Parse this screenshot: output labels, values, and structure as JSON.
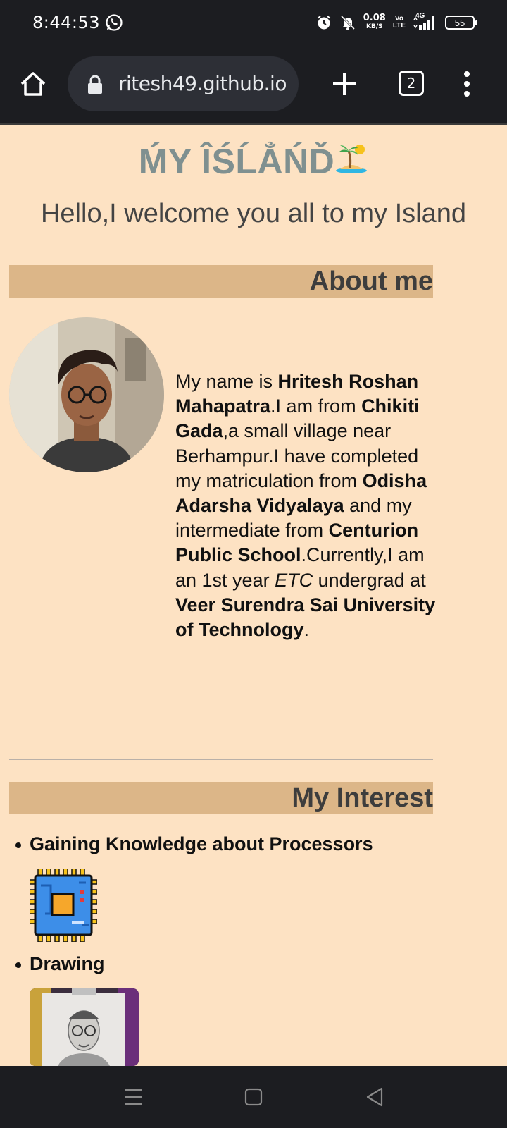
{
  "status_bar": {
    "time": "8:44:53",
    "net_speed_value": "0.08",
    "net_speed_unit": "KB/S",
    "volte_top": "Vo",
    "volte_bottom": "LTE",
    "network": "4G",
    "battery": "55"
  },
  "browser": {
    "url": "ritesh49.github.io",
    "tab_count": "2"
  },
  "page": {
    "title": "ḾY ÎŚĹẲŃĎ",
    "title_emoji": "island-icon",
    "welcome": "Hello,I welcome you all to my Island",
    "about_heading": "About me",
    "bio": [
      {
        "t": "My name is ",
        "b": false
      },
      {
        "t": "Hritesh Roshan Mahapatra",
        "b": true
      },
      {
        "t": ".I am from ",
        "b": false
      },
      {
        "t": "Chikiti Gada",
        "b": true
      },
      {
        "t": ",a small village near Berhampur.I have completed my matriculation from ",
        "b": false
      },
      {
        "t": "Odisha Adarsha Vidyalaya",
        "b": true
      },
      {
        "t": " and my intermediate from ",
        "b": false
      },
      {
        "t": "Centurion Public School",
        "b": true
      },
      {
        "t": ".Currently,I am an 1st year ",
        "b": false
      },
      {
        "t": "ETC",
        "b": false,
        "i": true
      },
      {
        "t": " undergrad at ",
        "b": false
      },
      {
        "t": "Veer Surendra Sai University of Technology",
        "b": true
      },
      {
        "t": ".",
        "b": false
      }
    ],
    "interest_heading": "My Interest",
    "interests": [
      {
        "label": "Gaining Knowledge about Processors",
        "image": "processor-chip-icon"
      },
      {
        "label": "Drawing",
        "image": "pencil-sketch-photo"
      }
    ]
  },
  "colors": {
    "page_bg": "#fde2c3",
    "section_bar": "#dcb688",
    "title": "#7f9090",
    "chrome_bg": "#1c1d21"
  }
}
